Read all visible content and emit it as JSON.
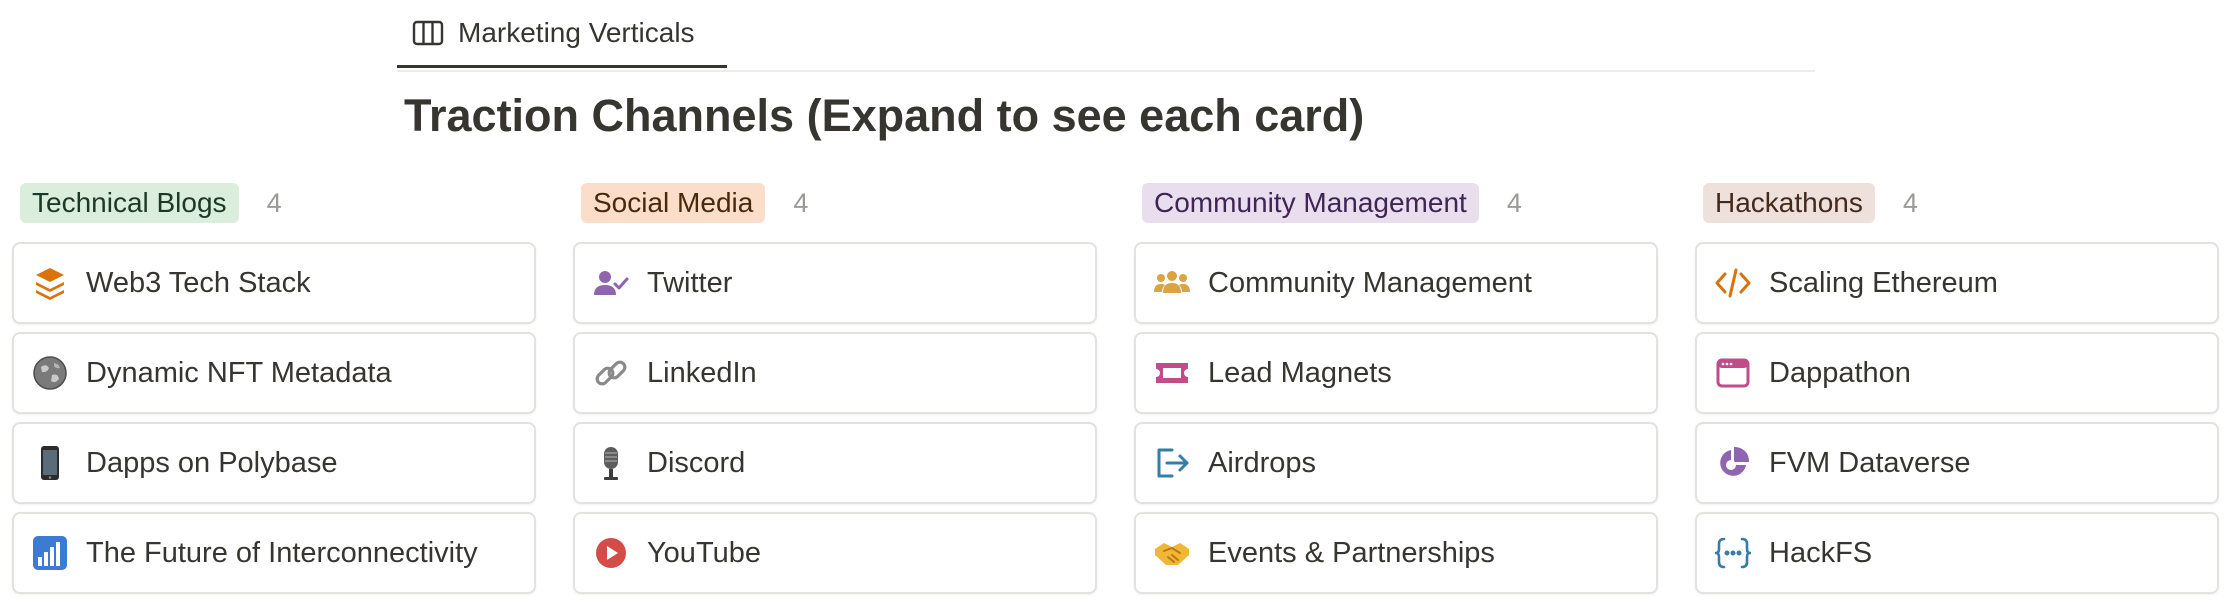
{
  "view_tab": {
    "label": "Marketing Verticals",
    "icon": "board-columns-icon"
  },
  "title": "Traction Channels (Expand to see each card)",
  "columns": [
    {
      "tag": "Technical Blogs",
      "count": "4",
      "tag_bg": "#dbeddb",
      "tag_fg": "#1c3829",
      "cards": [
        {
          "label": "Web3 Tech Stack",
          "icon": "layers-icon",
          "color": "#d9730d"
        },
        {
          "label": "Dynamic NFT Metadata",
          "icon": "globe-emoji-icon",
          "color": "#6b6b6b"
        },
        {
          "label": "Dapps on Polybase",
          "icon": "mobile-phone-emoji-icon",
          "color": "#222222"
        },
        {
          "label": "The Future of Interconnectivity",
          "icon": "bar-chart-emoji-icon",
          "color": "#3b7bd4"
        }
      ]
    },
    {
      "tag": "Social Media",
      "count": "4",
      "tag_bg": "#fadec9",
      "tag_fg": "#49290e",
      "cards": [
        {
          "label": "Twitter",
          "icon": "user-check-icon",
          "color": "#9065b0"
        },
        {
          "label": "LinkedIn",
          "icon": "link-emoji-icon",
          "color": "#8a8a8a"
        },
        {
          "label": "Discord",
          "icon": "microphone-emoji-icon",
          "color": "#555555"
        },
        {
          "label": "YouTube",
          "icon": "play-circle-icon",
          "color": "#d44c47"
        }
      ]
    },
    {
      "tag": "Community Management",
      "count": "4",
      "tag_bg": "#e8deee",
      "tag_fg": "#412454",
      "cards": [
        {
          "label": "Community Management",
          "icon": "people-group-icon",
          "color": "#dfab01"
        },
        {
          "label": "Lead Magnets",
          "icon": "ticket-icon",
          "color": "#c14c8a"
        },
        {
          "label": "Airdrops",
          "icon": "exit-arrow-icon",
          "color": "#337ea9"
        },
        {
          "label": "Events & Partnerships",
          "icon": "handshake-emoji-icon",
          "color": "#e6a23c"
        }
      ]
    },
    {
      "tag": "Hackathons",
      "count": "4",
      "tag_bg": "#eee0da",
      "tag_fg": "#442a1e",
      "cards": [
        {
          "label": "Scaling Ethereum",
          "icon": "code-icon",
          "color": "#d9730d"
        },
        {
          "label": "Dappathon",
          "icon": "browser-window-icon",
          "color": "#c14c8a"
        },
        {
          "label": "FVM Dataverse",
          "icon": "pie-chart-icon",
          "color": "#9065b0"
        },
        {
          "label": "HackFS",
          "icon": "braces-icon",
          "color": "#337ea9"
        }
      ]
    }
  ]
}
